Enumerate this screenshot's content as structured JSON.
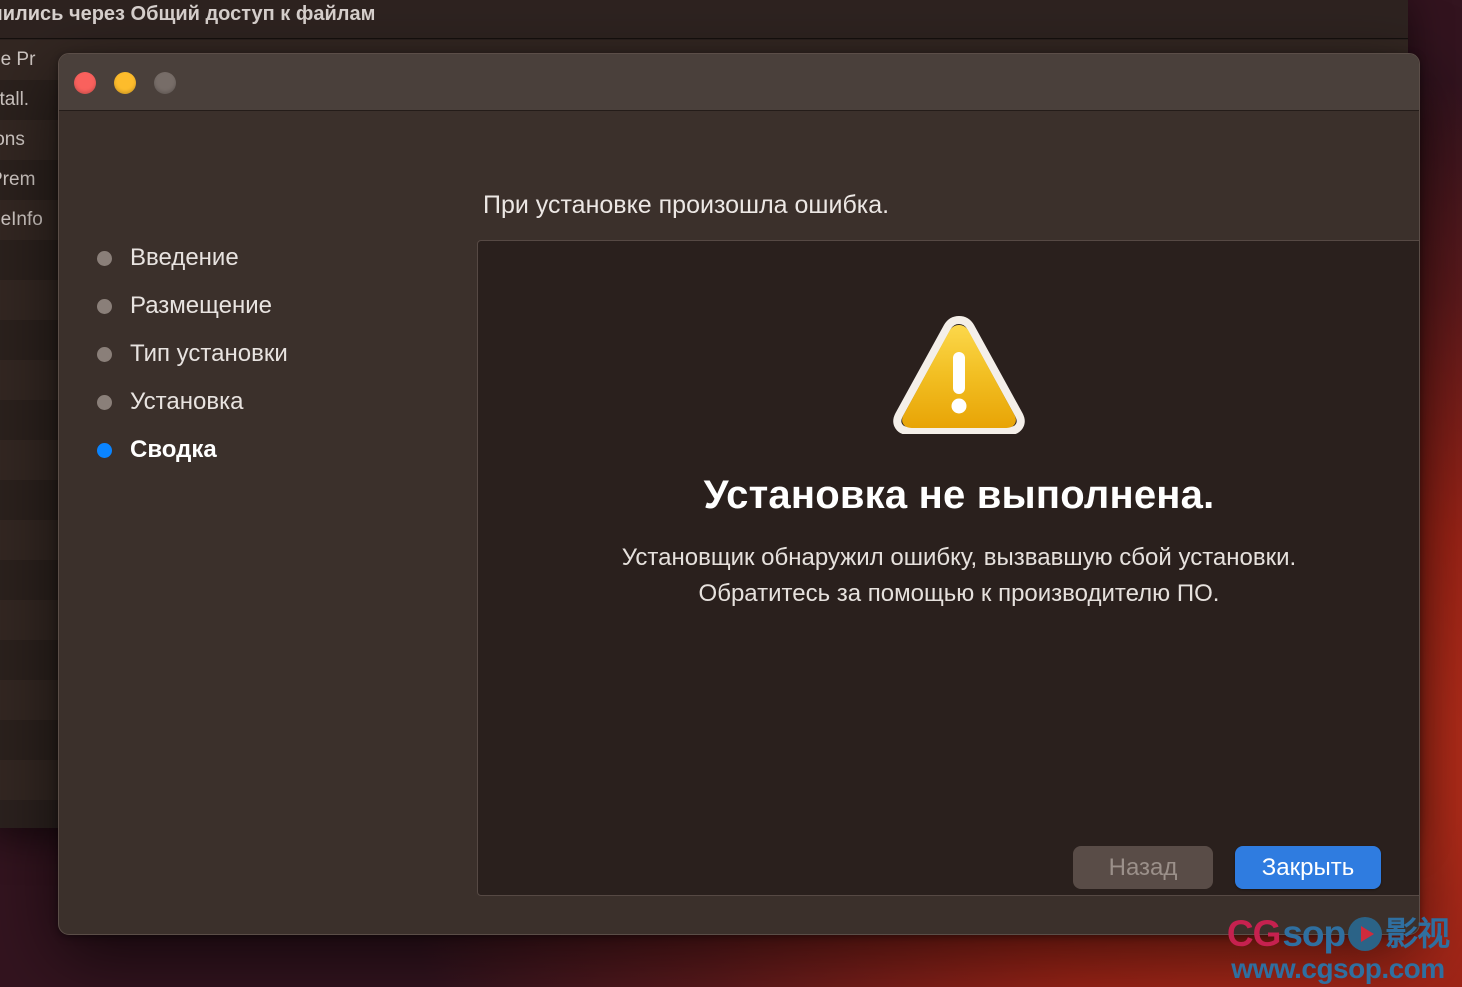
{
  "background_window": {
    "title": "лились через Общий доступ к файлам",
    "rows": [
      "be Pr",
      "stall.",
      "ions",
      "Prem",
      "geInfo",
      "",
      "",
      "",
      "",
      "",
      "",
      "",
      "",
      "",
      "",
      "",
      "",
      "",
      ""
    ]
  },
  "installer": {
    "window_controls": {
      "close": "close-button",
      "minimize": "minimize-button",
      "zoom": "zoom-button"
    },
    "sidebar": {
      "items": [
        {
          "label": "Введение",
          "state": "done"
        },
        {
          "label": "Размещение",
          "state": "done"
        },
        {
          "label": "Тип установки",
          "state": "done"
        },
        {
          "label": "Установка",
          "state": "done"
        },
        {
          "label": "Сводка",
          "state": "current"
        }
      ]
    },
    "main": {
      "heading": "При установке произошла ошибка.",
      "icon": "warning-triangle-icon",
      "fail_title": "Установка не выполнена.",
      "fail_line1": "Установщик обнаружил ошибку, вызвавшую сбой установки.",
      "fail_line2": "Обратитесь за помощью к производителю ПО."
    },
    "footer": {
      "back_label": "Назад",
      "close_label": "Закрыть"
    }
  },
  "watermark": {
    "brand_cg": "CG",
    "brand_sop": "sop",
    "brand_cn": "影视",
    "url": "www.cgsop.com"
  },
  "colors": {
    "accent_blue": "#0a84ff",
    "primary_button": "#2f7ce0",
    "warning_yellow": "#f0b922",
    "traffic_red": "#f9615d",
    "traffic_yellow": "#fdbc2c",
    "traffic_gray": "#776d68"
  }
}
